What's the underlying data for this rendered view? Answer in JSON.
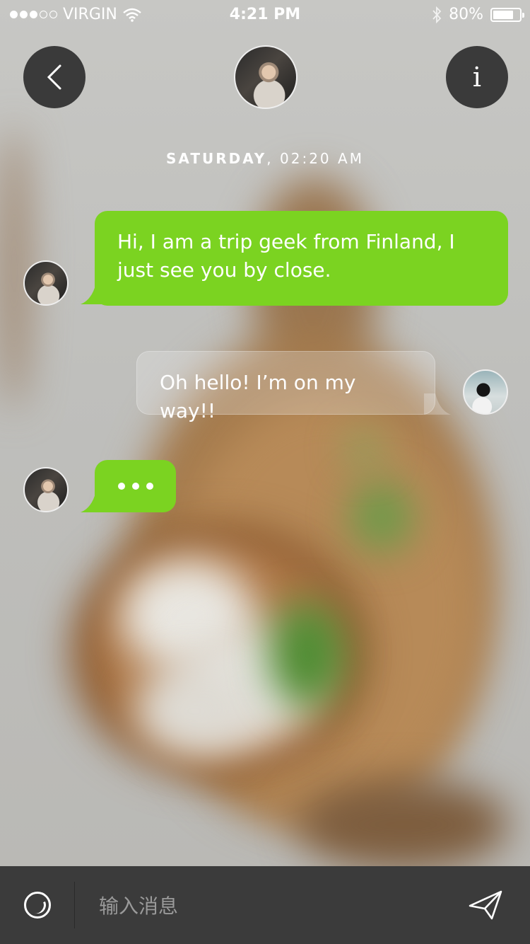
{
  "status_bar": {
    "carrier": "VIRGIN",
    "signal_bars_filled": 3,
    "signal_bars_total": 5,
    "time": "4:21 PM",
    "battery": "80%",
    "battery_level": 0.8
  },
  "header": {
    "back_icon": "chevron-left-icon",
    "info_label": "i"
  },
  "conversation": {
    "date_day": "SATURDAY",
    "date_time": ", 02:20 AM",
    "messages": [
      {
        "from": "other",
        "text": "Hi, I am a trip geek from Finland, I just see you by close."
      },
      {
        "from": "me",
        "text": "Oh hello! I’m on my way!!"
      },
      {
        "from": "other",
        "typing": true
      }
    ]
  },
  "composer": {
    "placeholder": "输入消息",
    "emoji_icon": "smiley-icon",
    "send_icon": "paper-plane-icon"
  },
  "colors": {
    "accent_green": "#7BD321",
    "dark_button": "#3A3A3A",
    "input_bar": "#3B3B3B"
  }
}
